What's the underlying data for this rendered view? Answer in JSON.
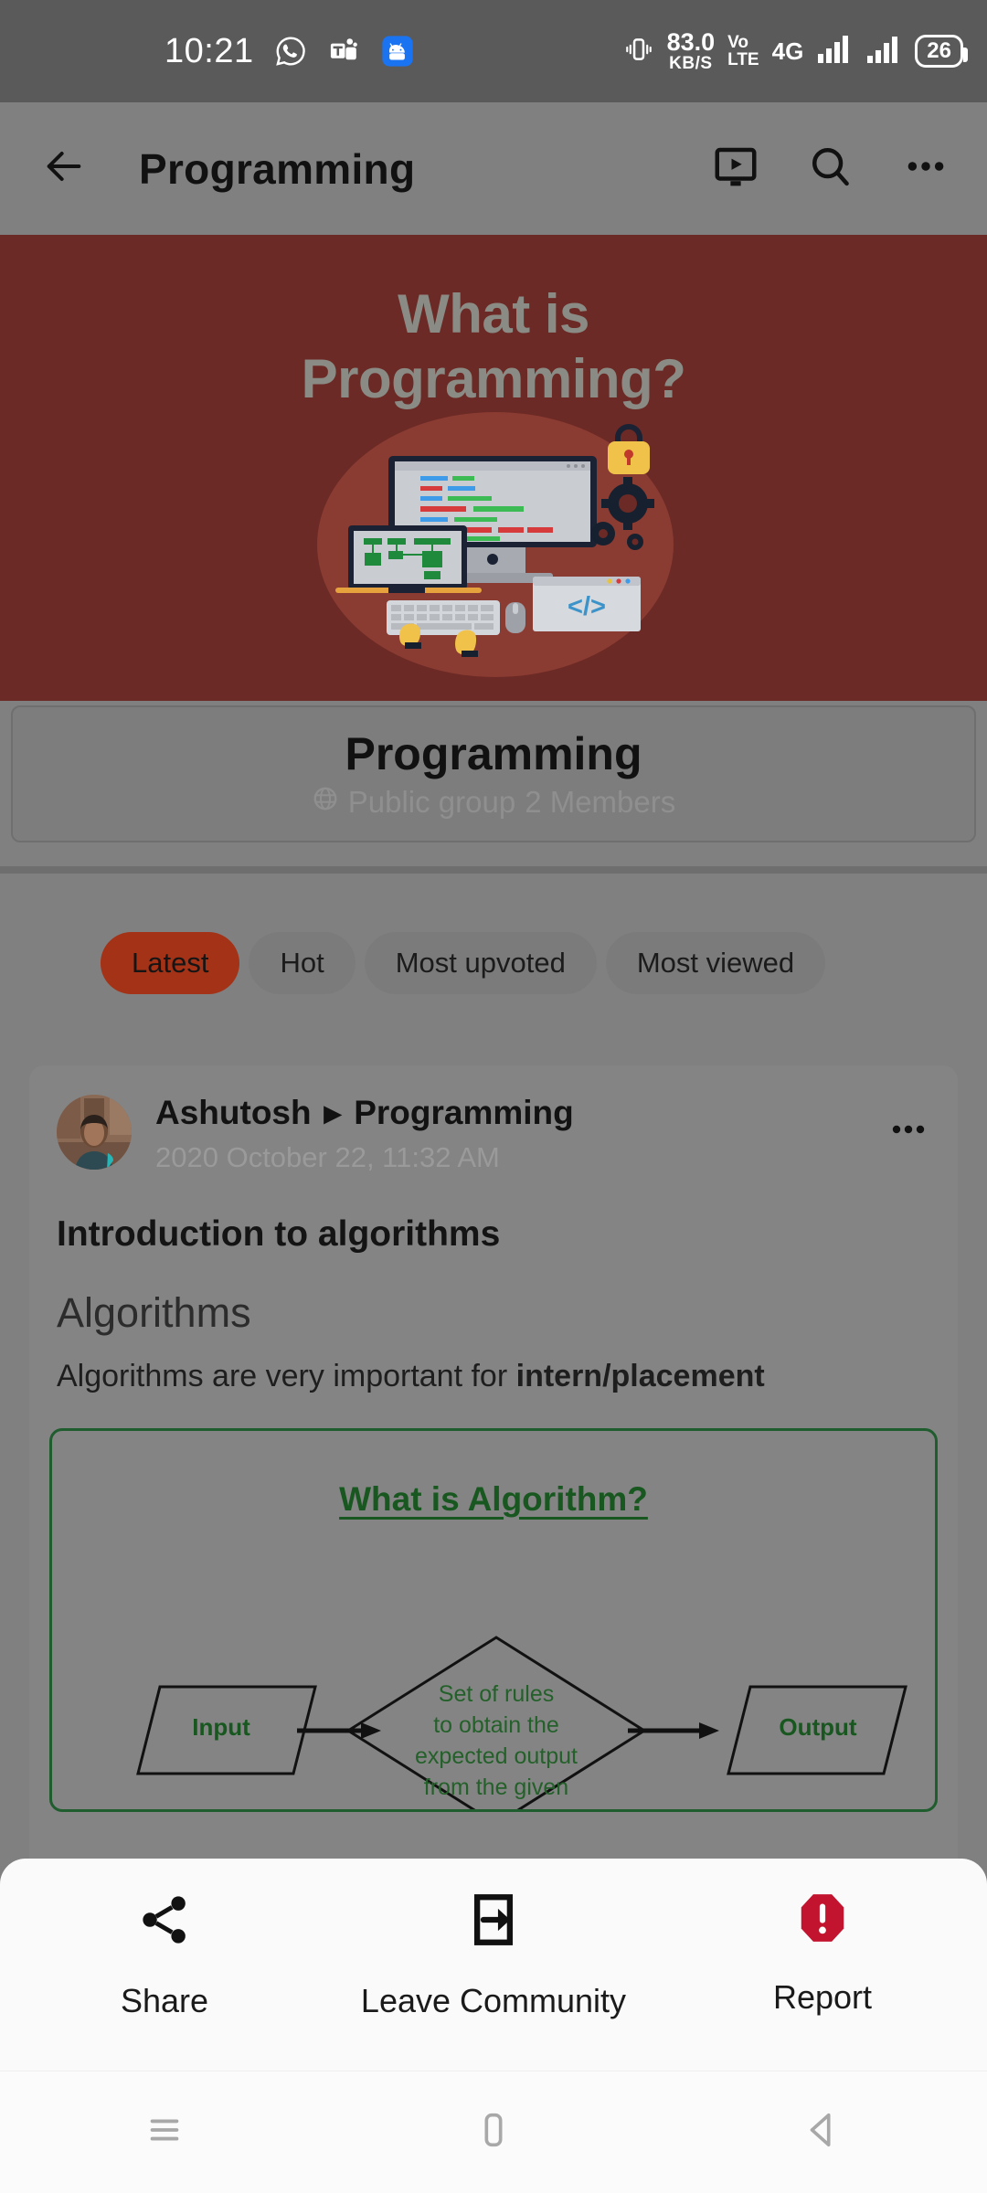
{
  "status_bar": {
    "time": "10:21",
    "app_icons": [
      "whatsapp-icon",
      "microsoft-teams-icon",
      "android-messages-icon"
    ],
    "network_speed_value": "83.0",
    "network_speed_unit": "KB/S",
    "volte_line1": "Vo",
    "volte_line2": "LTE",
    "network_type": "4G",
    "battery_level": "26"
  },
  "app_bar": {
    "back_icon": "arrow-left-icon",
    "title": "Programming",
    "actions": [
      "video-tutorial-icon",
      "search-icon",
      "overflow-menu-icon"
    ]
  },
  "banner": {
    "line1": "What is",
    "line2": "Programming?",
    "background_color": "#6b2a25",
    "text_color": "#8b8b85",
    "code_snippet_label": "</>"
  },
  "group_card": {
    "name": "Programming",
    "visibility_icon": "globe-icon",
    "visibility": "Public group",
    "members": "2 Members"
  },
  "filter_chips": [
    {
      "label": "Latest",
      "active": true
    },
    {
      "label": "Hot",
      "active": false
    },
    {
      "label": "Most upvoted",
      "active": false
    },
    {
      "label": "Most viewed",
      "active": false
    }
  ],
  "post": {
    "avatar_name": "avatar",
    "author": "Ashutosh",
    "separator": "▸",
    "community": "Programming",
    "timestamp": "2020 October 22, 11:32 AM",
    "more_icon": "overflow-menu-icon",
    "title": "Introduction to algorithms",
    "heading": "Algorithms",
    "body_plain": "Algorithms are very important for ",
    "body_bold": "intern/placement",
    "attachment": {
      "title": "What is Algorithm?",
      "input_label": "Input",
      "decision_line1": "Set of rules",
      "decision_line2": "to obtain the",
      "decision_line3": "expected output",
      "decision_line4": "from the given",
      "output_label": "Output",
      "border_color": "#1f5c2e",
      "text_color": "#18571f"
    }
  },
  "bottom_sheet": {
    "items": [
      {
        "label": "Share",
        "icon": "share-icon"
      },
      {
        "label": "Leave Community",
        "icon": "exit-icon"
      },
      {
        "label": "Report",
        "icon": "report-icon"
      }
    ],
    "report_color": "#c2142e"
  },
  "nav_bar": {
    "recents_icon": "recents-icon",
    "home_icon": "home-icon",
    "back_icon": "back-triangle-icon"
  }
}
